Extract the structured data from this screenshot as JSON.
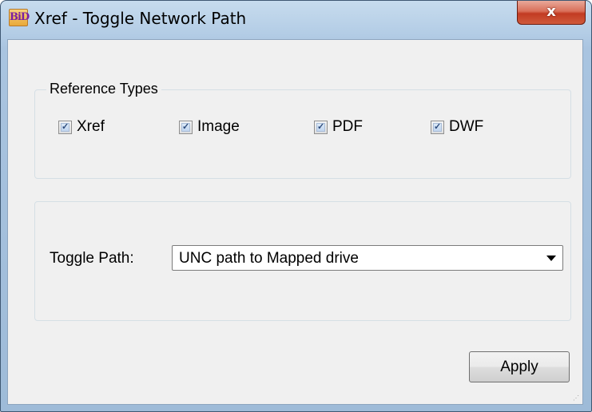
{
  "window": {
    "title": "Xref - Toggle Network Path",
    "icon_name": "app-logo-icon",
    "close_label": "x"
  },
  "reference_types": {
    "legend": "Reference Types",
    "items": [
      {
        "label": "Xref",
        "checked": true
      },
      {
        "label": "Image",
        "checked": true
      },
      {
        "label": "PDF",
        "checked": true
      },
      {
        "label": "DWF",
        "checked": true
      }
    ]
  },
  "toggle": {
    "label": "Toggle Path:",
    "selected": "UNC path to Mapped drive"
  },
  "buttons": {
    "apply": "Apply"
  },
  "colors": {
    "title_bar": "#b4cde6",
    "close_button": "#c23b22",
    "dialog_body": "#f0f0f0"
  }
}
